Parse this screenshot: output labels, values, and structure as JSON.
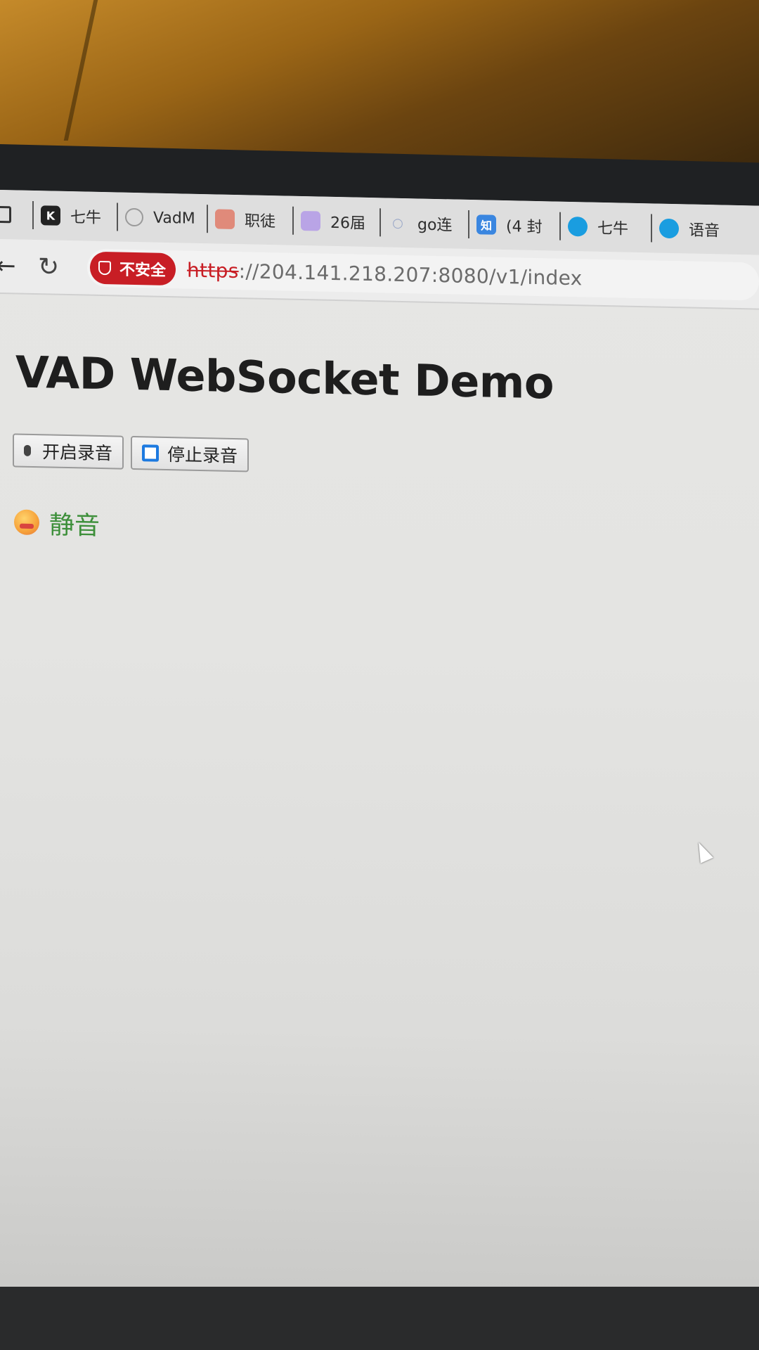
{
  "bookmarks": [
    {
      "label": "七牛",
      "icon": "k-logo-icon",
      "icon_text": "K",
      "color": "#222222"
    },
    {
      "label": "VadM",
      "icon": "openai-icon",
      "icon_text": "",
      "color": "#9a9a9a"
    },
    {
      "label": "职徒",
      "icon": "bookmark-icon",
      "icon_text": "",
      "color": "#e08a7a"
    },
    {
      "label": "26届",
      "icon": "app-icon",
      "icon_text": "",
      "color": "#b9a4e6"
    },
    {
      "label": "go连",
      "icon": "search-icon",
      "icon_text": "",
      "color": "#cfd6e6"
    },
    {
      "label": "(4 封",
      "icon": "zhihu-icon",
      "icon_text": "知",
      "color": "#3a86e0"
    },
    {
      "label": "七牛",
      "icon": "qiniu-icon",
      "icon_text": "",
      "color": "#1a9de0"
    },
    {
      "label": "语音",
      "icon": "qiniu-icon",
      "icon_text": "",
      "color": "#1a9de0"
    }
  ],
  "address_bar": {
    "security_label": "不安全",
    "url_scheme": "https",
    "url_rest": "://204.141.218.207:8080/v1/index"
  },
  "page": {
    "title": "VAD WebSocket Demo",
    "start_button": "开启录音",
    "stop_button": "停止录音",
    "status": "静音"
  },
  "colors": {
    "security_badge": "#c81e25",
    "status_text": "#3d8f3a",
    "stop_icon": "#1d7ae0"
  }
}
